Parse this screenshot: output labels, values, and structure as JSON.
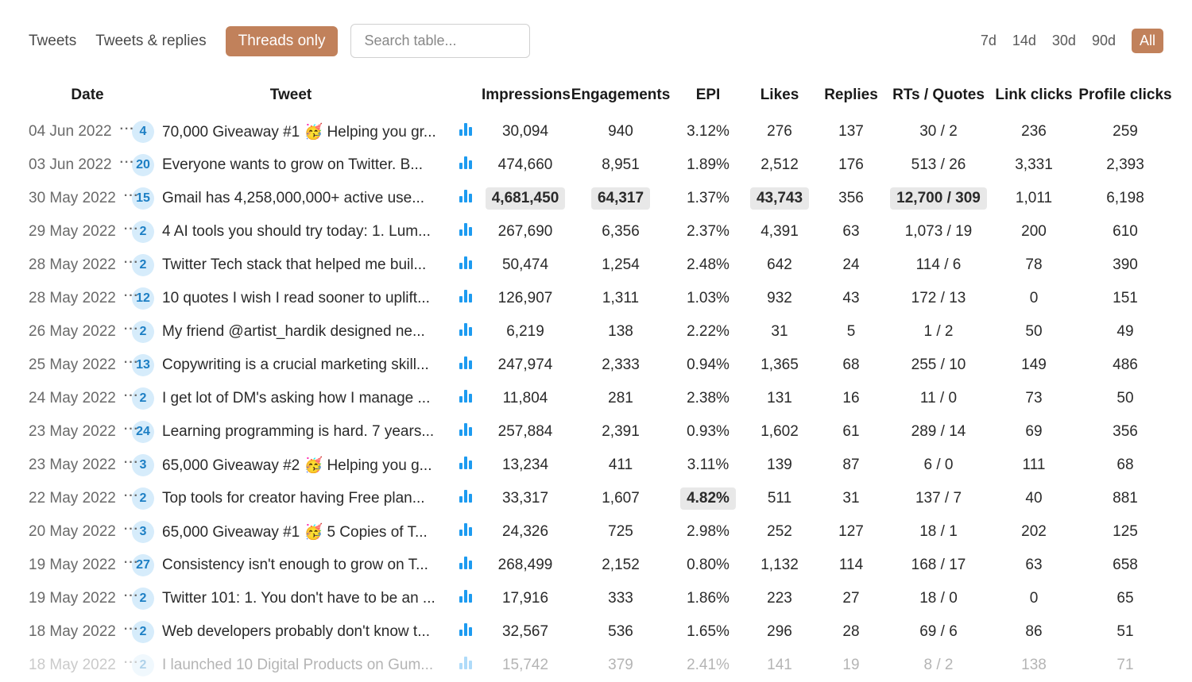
{
  "tabs": {
    "tweets": "Tweets",
    "tweets_replies": "Tweets & replies",
    "threads_only": "Threads only"
  },
  "search": {
    "placeholder": "Search table..."
  },
  "ranges": {
    "d7": "7d",
    "d14": "14d",
    "d30": "30d",
    "d90": "90d",
    "all": "All"
  },
  "columns": {
    "date": "Date",
    "tweet": "Tweet",
    "impressions": "Impressions",
    "engagements": "Engagements",
    "epi": "EPI",
    "likes": "Likes",
    "replies": "Replies",
    "rts_quotes": "RTs / Quotes",
    "link_clicks": "Link clicks",
    "profile_clicks": "Profile clicks"
  },
  "rows": [
    {
      "date": "04 Jun 2022",
      "badge": "4",
      "text": "70,000 Giveaway #1 🥳 Helping you gr...",
      "impressions": "30,094",
      "engagements": "940",
      "epi": "3.12%",
      "likes": "276",
      "replies": "137",
      "rts": "30 / 2",
      "link": "236",
      "profile": "259"
    },
    {
      "date": "03 Jun 2022",
      "badge": "20",
      "text": "Everyone wants to grow on Twitter. B...",
      "impressions": "474,660",
      "engagements": "8,951",
      "epi": "1.89%",
      "likes": "2,512",
      "replies": "176",
      "rts": "513 / 26",
      "link": "3,331",
      "profile": "2,393"
    },
    {
      "date": "30 May 2022",
      "badge": "15",
      "text": "Gmail has 4,258,000,000+ active use...",
      "impressions": "4,681,450",
      "engagements": "64,317",
      "epi": "1.37%",
      "likes": "43,743",
      "replies": "356",
      "rts": "12,700 / 309",
      "link": "1,011",
      "profile": "6,198",
      "hl": {
        "impressions": true,
        "engagements": true,
        "likes": true,
        "rts": true
      }
    },
    {
      "date": "29 May 2022",
      "badge": "2",
      "text": "4 AI tools you should try today: 1. Lum...",
      "impressions": "267,690",
      "engagements": "6,356",
      "epi": "2.37%",
      "likes": "4,391",
      "replies": "63",
      "rts": "1,073 / 19",
      "link": "200",
      "profile": "610"
    },
    {
      "date": "28 May 2022",
      "badge": "2",
      "text": "Twitter Tech stack that helped me buil...",
      "impressions": "50,474",
      "engagements": "1,254",
      "epi": "2.48%",
      "likes": "642",
      "replies": "24",
      "rts": "114 / 6",
      "link": "78",
      "profile": "390"
    },
    {
      "date": "28 May 2022",
      "badge": "12",
      "text": "10 quotes I wish I read sooner to uplift...",
      "impressions": "126,907",
      "engagements": "1,311",
      "epi": "1.03%",
      "likes": "932",
      "replies": "43",
      "rts": "172 / 13",
      "link": "0",
      "profile": "151"
    },
    {
      "date": "26 May 2022",
      "badge": "2",
      "text": "My friend @artist_hardik designed ne...",
      "impressions": "6,219",
      "engagements": "138",
      "epi": "2.22%",
      "likes": "31",
      "replies": "5",
      "rts": "1 / 2",
      "link": "50",
      "profile": "49"
    },
    {
      "date": "25 May 2022",
      "badge": "13",
      "text": "Copywriting is a crucial marketing skill...",
      "impressions": "247,974",
      "engagements": "2,333",
      "epi": "0.94%",
      "likes": "1,365",
      "replies": "68",
      "rts": "255 / 10",
      "link": "149",
      "profile": "486"
    },
    {
      "date": "24 May 2022",
      "badge": "2",
      "text": "I get lot of DM's asking how I manage ...",
      "impressions": "11,804",
      "engagements": "281",
      "epi": "2.38%",
      "likes": "131",
      "replies": "16",
      "rts": "11 / 0",
      "link": "73",
      "profile": "50"
    },
    {
      "date": "23 May 2022",
      "badge": "24",
      "text": "Learning programming is hard. 7 years...",
      "impressions": "257,884",
      "engagements": "2,391",
      "epi": "0.93%",
      "likes": "1,602",
      "replies": "61",
      "rts": "289 / 14",
      "link": "69",
      "profile": "356"
    },
    {
      "date": "23 May 2022",
      "badge": "3",
      "text": "65,000 Giveaway #2 🥳 Helping you g...",
      "impressions": "13,234",
      "engagements": "411",
      "epi": "3.11%",
      "likes": "139",
      "replies": "87",
      "rts": "6 / 0",
      "link": "111",
      "profile": "68"
    },
    {
      "date": "22 May 2022",
      "badge": "2",
      "text": "Top tools for creator having Free plan...",
      "impressions": "33,317",
      "engagements": "1,607",
      "epi": "4.82%",
      "likes": "511",
      "replies": "31",
      "rts": "137 / 7",
      "link": "40",
      "profile": "881",
      "hl": {
        "epi": true
      }
    },
    {
      "date": "20 May 2022",
      "badge": "3",
      "text": "65,000 Giveaway #1 🥳 5 Copies of T...",
      "impressions": "24,326",
      "engagements": "725",
      "epi": "2.98%",
      "likes": "252",
      "replies": "127",
      "rts": "18 / 1",
      "link": "202",
      "profile": "125"
    },
    {
      "date": "19 May 2022",
      "badge": "27",
      "text": "Consistency isn't enough to grow on T...",
      "impressions": "268,499",
      "engagements": "2,152",
      "epi": "0.80%",
      "likes": "1,132",
      "replies": "114",
      "rts": "168 / 17",
      "link": "63",
      "profile": "658"
    },
    {
      "date": "19 May 2022",
      "badge": "2",
      "text": "Twitter 101: 1. You don't have to be an ...",
      "impressions": "17,916",
      "engagements": "333",
      "epi": "1.86%",
      "likes": "223",
      "replies": "27",
      "rts": "18 / 0",
      "link": "0",
      "profile": "65"
    },
    {
      "date": "18 May 2022",
      "badge": "2",
      "text": "Web developers probably don't know t...",
      "impressions": "32,567",
      "engagements": "536",
      "epi": "1.65%",
      "likes": "296",
      "replies": "28",
      "rts": "69 / 6",
      "link": "86",
      "profile": "51"
    },
    {
      "date": "18 May 2022",
      "badge": "2",
      "text": "I launched 10 Digital Products on Gum...",
      "impressions": "15,742",
      "engagements": "379",
      "epi": "2.41%",
      "likes": "141",
      "replies": "19",
      "rts": "8 / 2",
      "link": "138",
      "profile": "71",
      "faded": true
    }
  ]
}
